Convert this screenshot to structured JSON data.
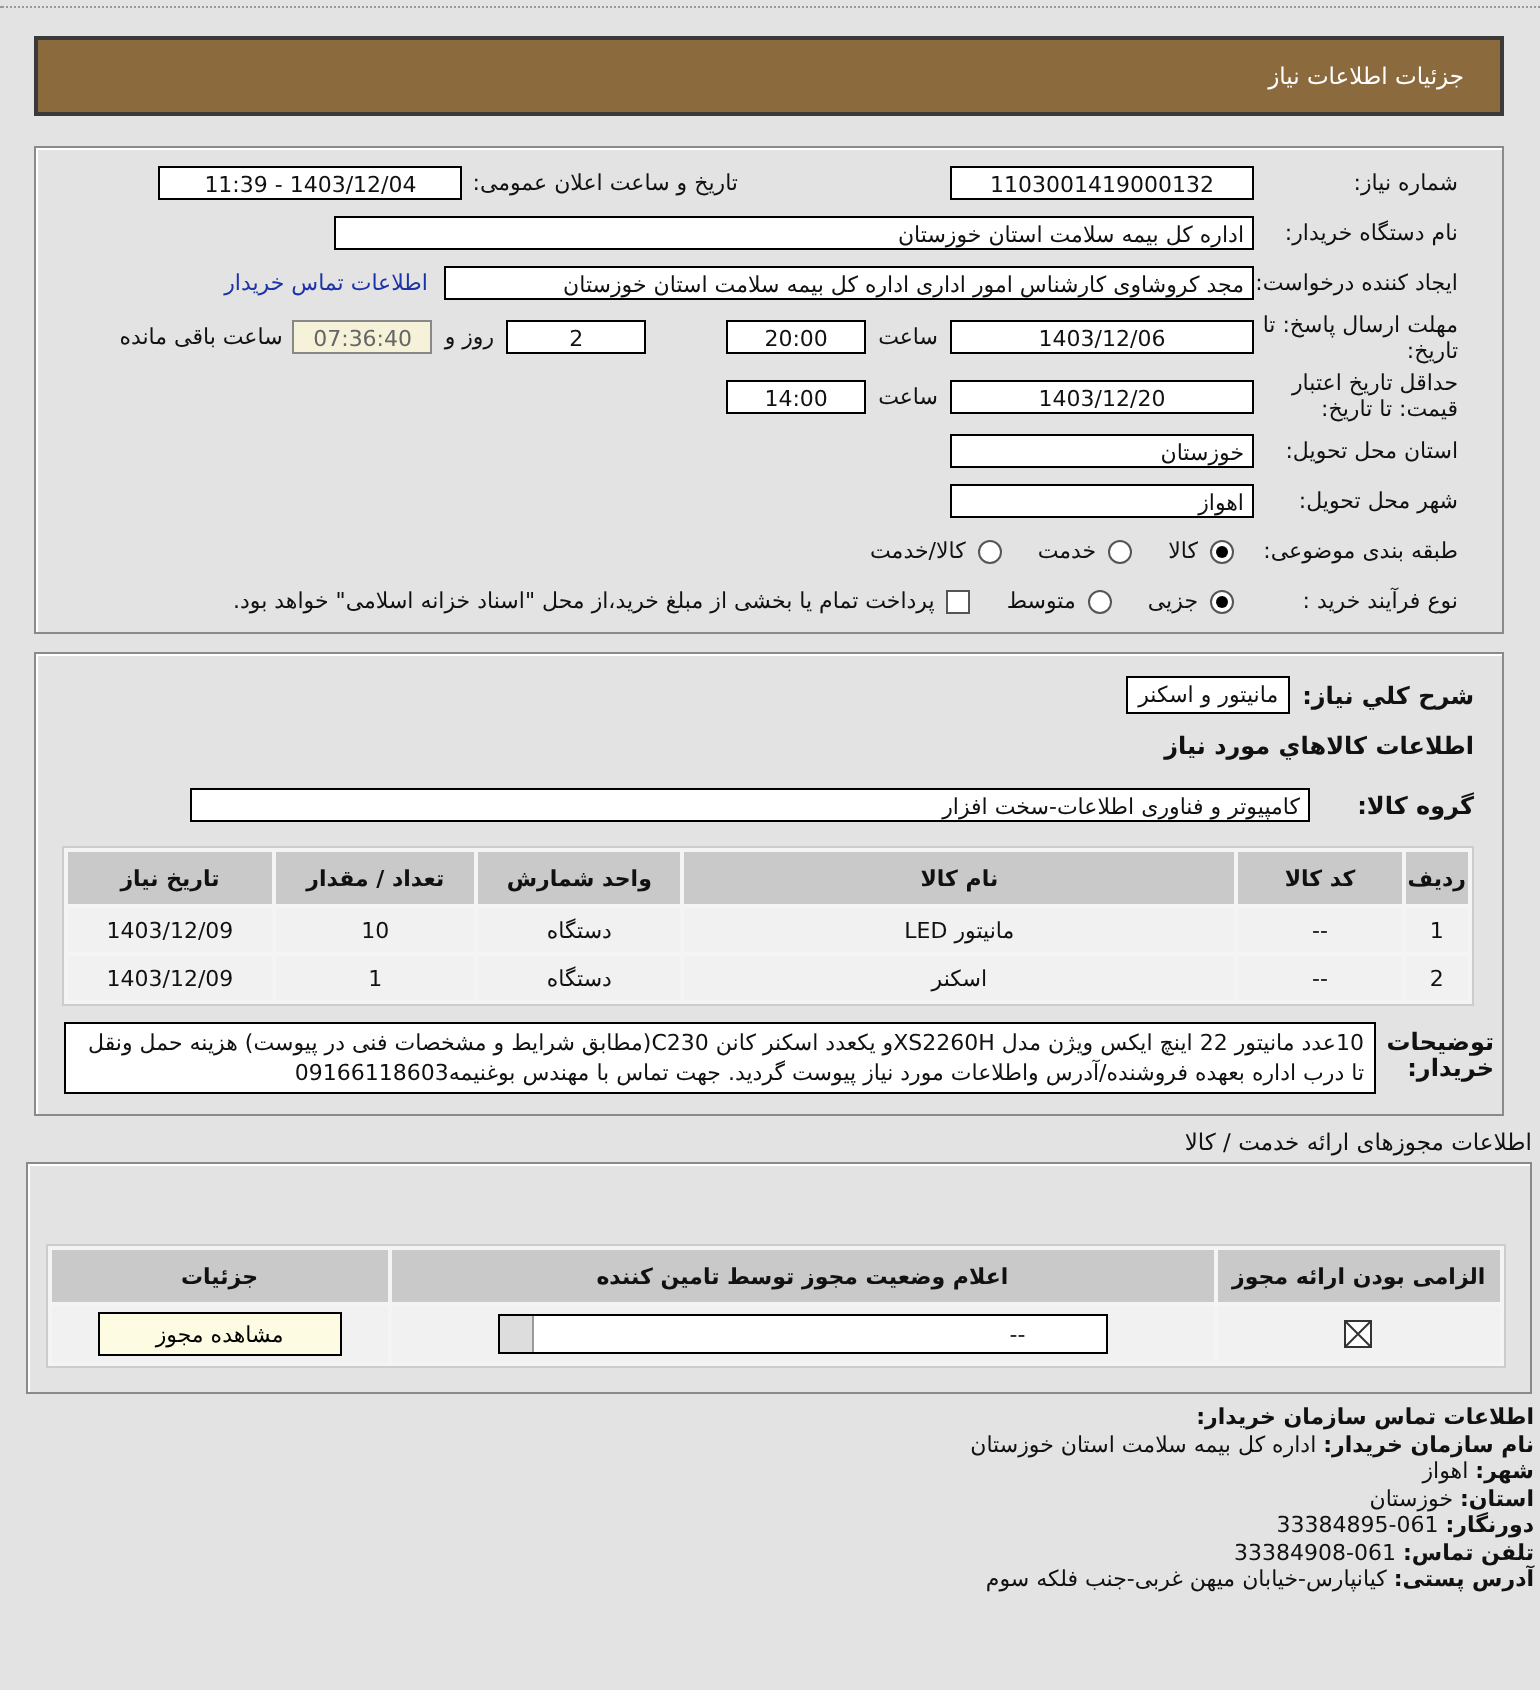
{
  "header": {
    "title": "جزئیات اطلاعات نیاز"
  },
  "need_info": {
    "need_number": {
      "label": "شماره نیاز:",
      "value": "1103001419000132"
    },
    "announce": {
      "label": "تاریخ و ساعت اعلان عمومی:",
      "value": "1403/12/04 - 11:39"
    },
    "buyer": {
      "label": "نام دستگاه خریدار:",
      "value": "اداره کل بیمه سلامت استان خوزستان"
    },
    "creator": {
      "label": "ایجاد کننده درخواست:",
      "value": "مجد کروشاوی کارشناس امور اداری اداره کل بیمه سلامت استان خوزستان",
      "link": "اطلاعات تماس خریدار"
    },
    "deadline": {
      "label": "مهلت ارسال پاسخ: تا تاریخ:",
      "date": "1403/12/06",
      "time_label": "ساعت",
      "time": "20:00",
      "days": "2",
      "days_label": "روز و",
      "remaining": "07:36:40",
      "remaining_label": "ساعت باقی مانده"
    },
    "validity": {
      "label": "حداقل تاریخ اعتبار قیمت: تا تاریخ:",
      "date": "1403/12/20",
      "time_label": "ساعت",
      "time": "14:00"
    },
    "province": {
      "label": "استان محل تحویل:",
      "value": "خوزستان"
    },
    "city": {
      "label": "شهر محل تحویل:",
      "value": "اهواز"
    },
    "category": {
      "label": "طبقه بندی موضوعی:",
      "options": [
        {
          "label": "کالا",
          "selected": true
        },
        {
          "label": "خدمت",
          "selected": false
        },
        {
          "label": "کالا/خدمت",
          "selected": false
        }
      ]
    },
    "process": {
      "label": "نوع فرآیند خرید :",
      "options": [
        {
          "label": "جزیی",
          "selected": true
        },
        {
          "label": "متوسط",
          "selected": false
        }
      ],
      "payment": {
        "checked": false,
        "label": "پرداخت تمام یا بخشی از مبلغ خرید،از محل \"اسناد خزانه اسلامی\" خواهد بود."
      }
    }
  },
  "goods": {
    "summary": {
      "label": "شرح کلي نیاز:",
      "value": "مانیتور و اسکنر"
    },
    "title": "اطلاعات کالاهاي مورد نیاز",
    "group": {
      "label": "گروه کالا:",
      "value": "کامپیوتر و فناوری اطلاعات-سخت افزار"
    },
    "table": {
      "columns": [
        "ردیف",
        "کد کالا",
        "نام کالا",
        "واحد شمارش",
        "تعداد / مقدار",
        "تاریخ نیاز"
      ],
      "rows": [
        [
          "1",
          "--",
          "مانیتور LED",
          "دستگاه",
          "10",
          "1403/12/09"
        ],
        [
          "2",
          "--",
          "اسکنر",
          "دستگاه",
          "1",
          "1403/12/09"
        ]
      ]
    },
    "notes": {
      "label": "توضیحات خریدار:",
      "text": "10عدد مانیتور 22 اینچ ایکس ویژن مدل XS2260Hو یکعدد اسکنر کانن C230(مطابق شرایط و مشخصات فنی در پیوست) هزینه حمل ونقل تا درب اداره بعهده فروشنده/آدرس واطلاعات مورد نیاز پیوست گردید. جهت تماس با مهندس بوغنیمه09166118603"
    }
  },
  "licenses": {
    "title": "اطلاعات مجوزهای ارائه خدمت / کالا",
    "columns": [
      "الزامی بودن ارائه مجوز",
      "اعلام وضعیت مجوز توسط تامین کننده",
      "جزئیات"
    ],
    "rows": [
      {
        "required": true,
        "status": "--",
        "action": "مشاهده مجوز"
      }
    ]
  },
  "contact": {
    "title": "اطلاعات تماس سازمان خریدار:",
    "lines": [
      {
        "label": "نام سازمان خریدار:",
        "value": "اداره کل بیمه سلامت استان خوزستان"
      },
      {
        "label": "شهر:",
        "value": "اهواز"
      },
      {
        "label": "استان:",
        "value": "خوزستان"
      },
      {
        "label": "دورنگار:",
        "value": "061-33384895"
      },
      {
        "label": "تلفن تماس:",
        "value": "061-33384908"
      },
      {
        "label": "آدرس پستی:",
        "value": "کیانپارس-خیابان میهن غربی-جنب فلکه سوم"
      }
    ]
  }
}
